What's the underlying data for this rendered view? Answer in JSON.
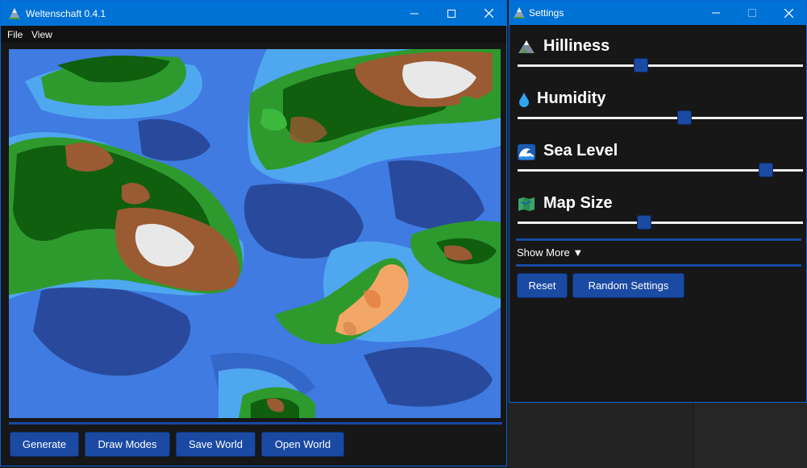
{
  "main_window": {
    "title": "Weltenschaft 0.4.1",
    "menu": [
      "File",
      "View"
    ],
    "buttons": {
      "generate": "Generate",
      "draw_modes": "Draw Modes",
      "save_world": "Save World",
      "open_world": "Open World"
    }
  },
  "settings_window": {
    "title": "Settings",
    "settings": [
      {
        "label": "Hilliness",
        "icon": "mountain-icon",
        "value": 0.43
      },
      {
        "label": "Humidity",
        "icon": "water-drop-icon",
        "value": 0.59
      },
      {
        "label": "Sea Level",
        "icon": "wave-icon",
        "value": 0.89
      },
      {
        "label": "Map Size",
        "icon": "map-icon",
        "value": 0.44
      }
    ],
    "show_more": "Show More ▼",
    "buttons": {
      "reset": "Reset",
      "random_settings": "Random Settings"
    }
  },
  "colors": {
    "titlebar_active": "#0072d6",
    "button": "#1b4aa3",
    "deep_ocean": "#294a9c",
    "ocean": "#3f7be1",
    "shallow": "#4fa7f0",
    "grass": "#2e9a2e",
    "forest": "#0f5f0f",
    "hills": "#9a5a32",
    "snow": "#e8e8e8",
    "desert": "#f2a668"
  }
}
